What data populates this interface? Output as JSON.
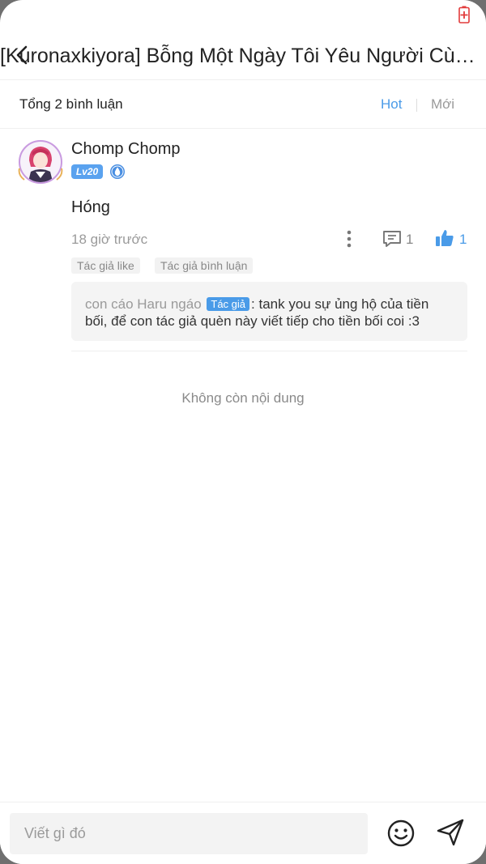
{
  "status": {
    "battery_icon": "battery-charging-icon",
    "battery_color": "#e23b3b"
  },
  "header": {
    "back_icon": "back-arrow-icon",
    "title": "[Kuronaxkiyora] Bỗng Một Ngày Tôi Yêu Người Cùng Giới..."
  },
  "comments_header": {
    "total": "Tổng 2 bình luận",
    "sort_hot": "Hot",
    "sort_new": "Mới",
    "accent_color": "#4a9be8"
  },
  "comment": {
    "username": "Chomp Chomp",
    "level": "Lv20",
    "text": "Hóng",
    "time": "18 giờ trước",
    "reply_count": "1",
    "like_count": "1",
    "tags": [
      "Tác giả like",
      "Tác giả bình luận"
    ],
    "reply": {
      "author": "con cáo Haru ngáo",
      "badge": "Tác giả",
      "text": ": tank you sự ủng hộ của tiền bối, để con tác giả quèn này viết tiếp cho tiền bối coi :3"
    }
  },
  "footer_message": "Không còn nội dung",
  "input": {
    "placeholder": "Viết gì đó"
  }
}
